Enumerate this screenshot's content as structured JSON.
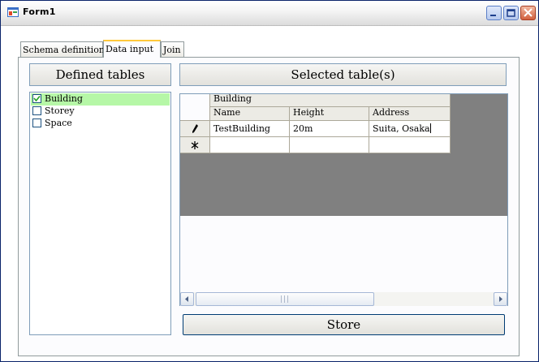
{
  "window": {
    "title": "Form1"
  },
  "tabs": [
    {
      "label": "Schema definition",
      "active": false
    },
    {
      "label": "Data input",
      "active": true
    },
    {
      "label": "Join",
      "active": false
    }
  ],
  "left_panel": {
    "header": "Defined tables",
    "items": [
      {
        "label": "Building",
        "checked": true,
        "selected": true
      },
      {
        "label": "Storey",
        "checked": false,
        "selected": false
      },
      {
        "label": "Space",
        "checked": false,
        "selected": false
      }
    ]
  },
  "right_panel": {
    "header": "Selected table(s)",
    "grid": {
      "group_header": "Building",
      "columns": [
        "Name",
        "Height",
        "Address"
      ],
      "rows": [
        {
          "indicator": "pencil-icon",
          "cells": [
            "TestBuilding",
            "20m",
            "Suita, Osaka"
          ]
        },
        {
          "indicator": "new-row-icon",
          "cells": [
            "",
            "",
            ""
          ]
        }
      ],
      "scroll_grip": "|||"
    },
    "store_label": "Store"
  },
  "colors": {
    "selected_row": "#b6f7a7",
    "grid_empty": "#808080",
    "active_tab_accent": "#ffc83c"
  }
}
